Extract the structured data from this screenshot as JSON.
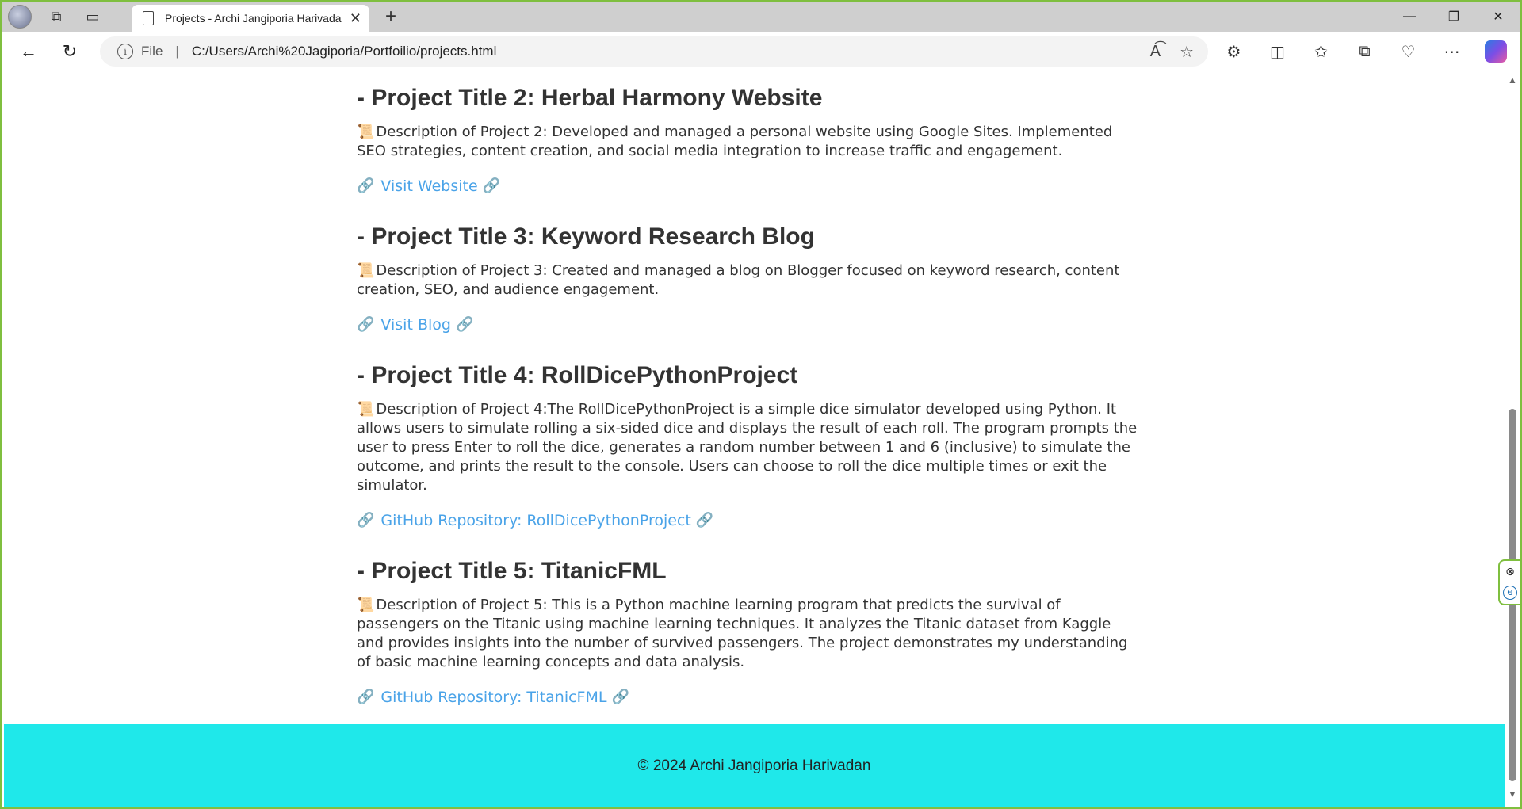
{
  "browser": {
    "tab_title": "Projects - Archi Jangiporia Harivadan",
    "address_scheme": "File",
    "address_url": "C:/Users/Archi%20Jagiporia/Portfoilio/projects.html",
    "new_tab": "+",
    "window_controls": {
      "minimize": "—",
      "restore": "❐",
      "close": "✕"
    },
    "accent_color": "#7fbf3f"
  },
  "projects": [
    {
      "title": "- Project Title 2: Herbal Harmony Website",
      "description": "Description of Project 2: Developed and managed a personal website using Google Sites. Implemented SEO strategies, content creation, and social media integration to increase traffic and engagement.",
      "link_text": "Visit Website"
    },
    {
      "title": "- Project Title 3: Keyword Research Blog",
      "description": "Description of Project 3: Created and managed a blog on Blogger focused on keyword research, content creation, SEO, and audience engagement.",
      "link_text": "Visit Blog"
    },
    {
      "title": "- Project Title 4: RollDicePythonProject",
      "description": "Description of Project 4:The RollDicePythonProject is a simple dice simulator developed using Python. It allows users to simulate rolling a six-sided dice and displays the result of each roll. The program prompts the user to press Enter to roll the dice, generates a random number between 1 and 6 (inclusive) to simulate the outcome, and prints the result to the console. Users can choose to roll the dice multiple times or exit the simulator.",
      "link_text": "GitHub Repository: RollDicePythonProject"
    },
    {
      "title": "- Project Title 5: TitanicFML",
      "description": "Description of Project 5: This is a Python machine learning program that predicts the survival of passengers on the Titanic using machine learning techniques. It analyzes the Titanic dataset from Kaggle and provides insights into the number of survived passengers. The project demonstrates my understanding of basic machine learning concepts and data analysis.",
      "link_text": "GitHub Repository: TitanicFML"
    }
  ],
  "footer": {
    "text": "© 2024 Archi Jangiporia Harivadan",
    "background": "#1fe8ea"
  },
  "link_color": "#4aa3e8"
}
